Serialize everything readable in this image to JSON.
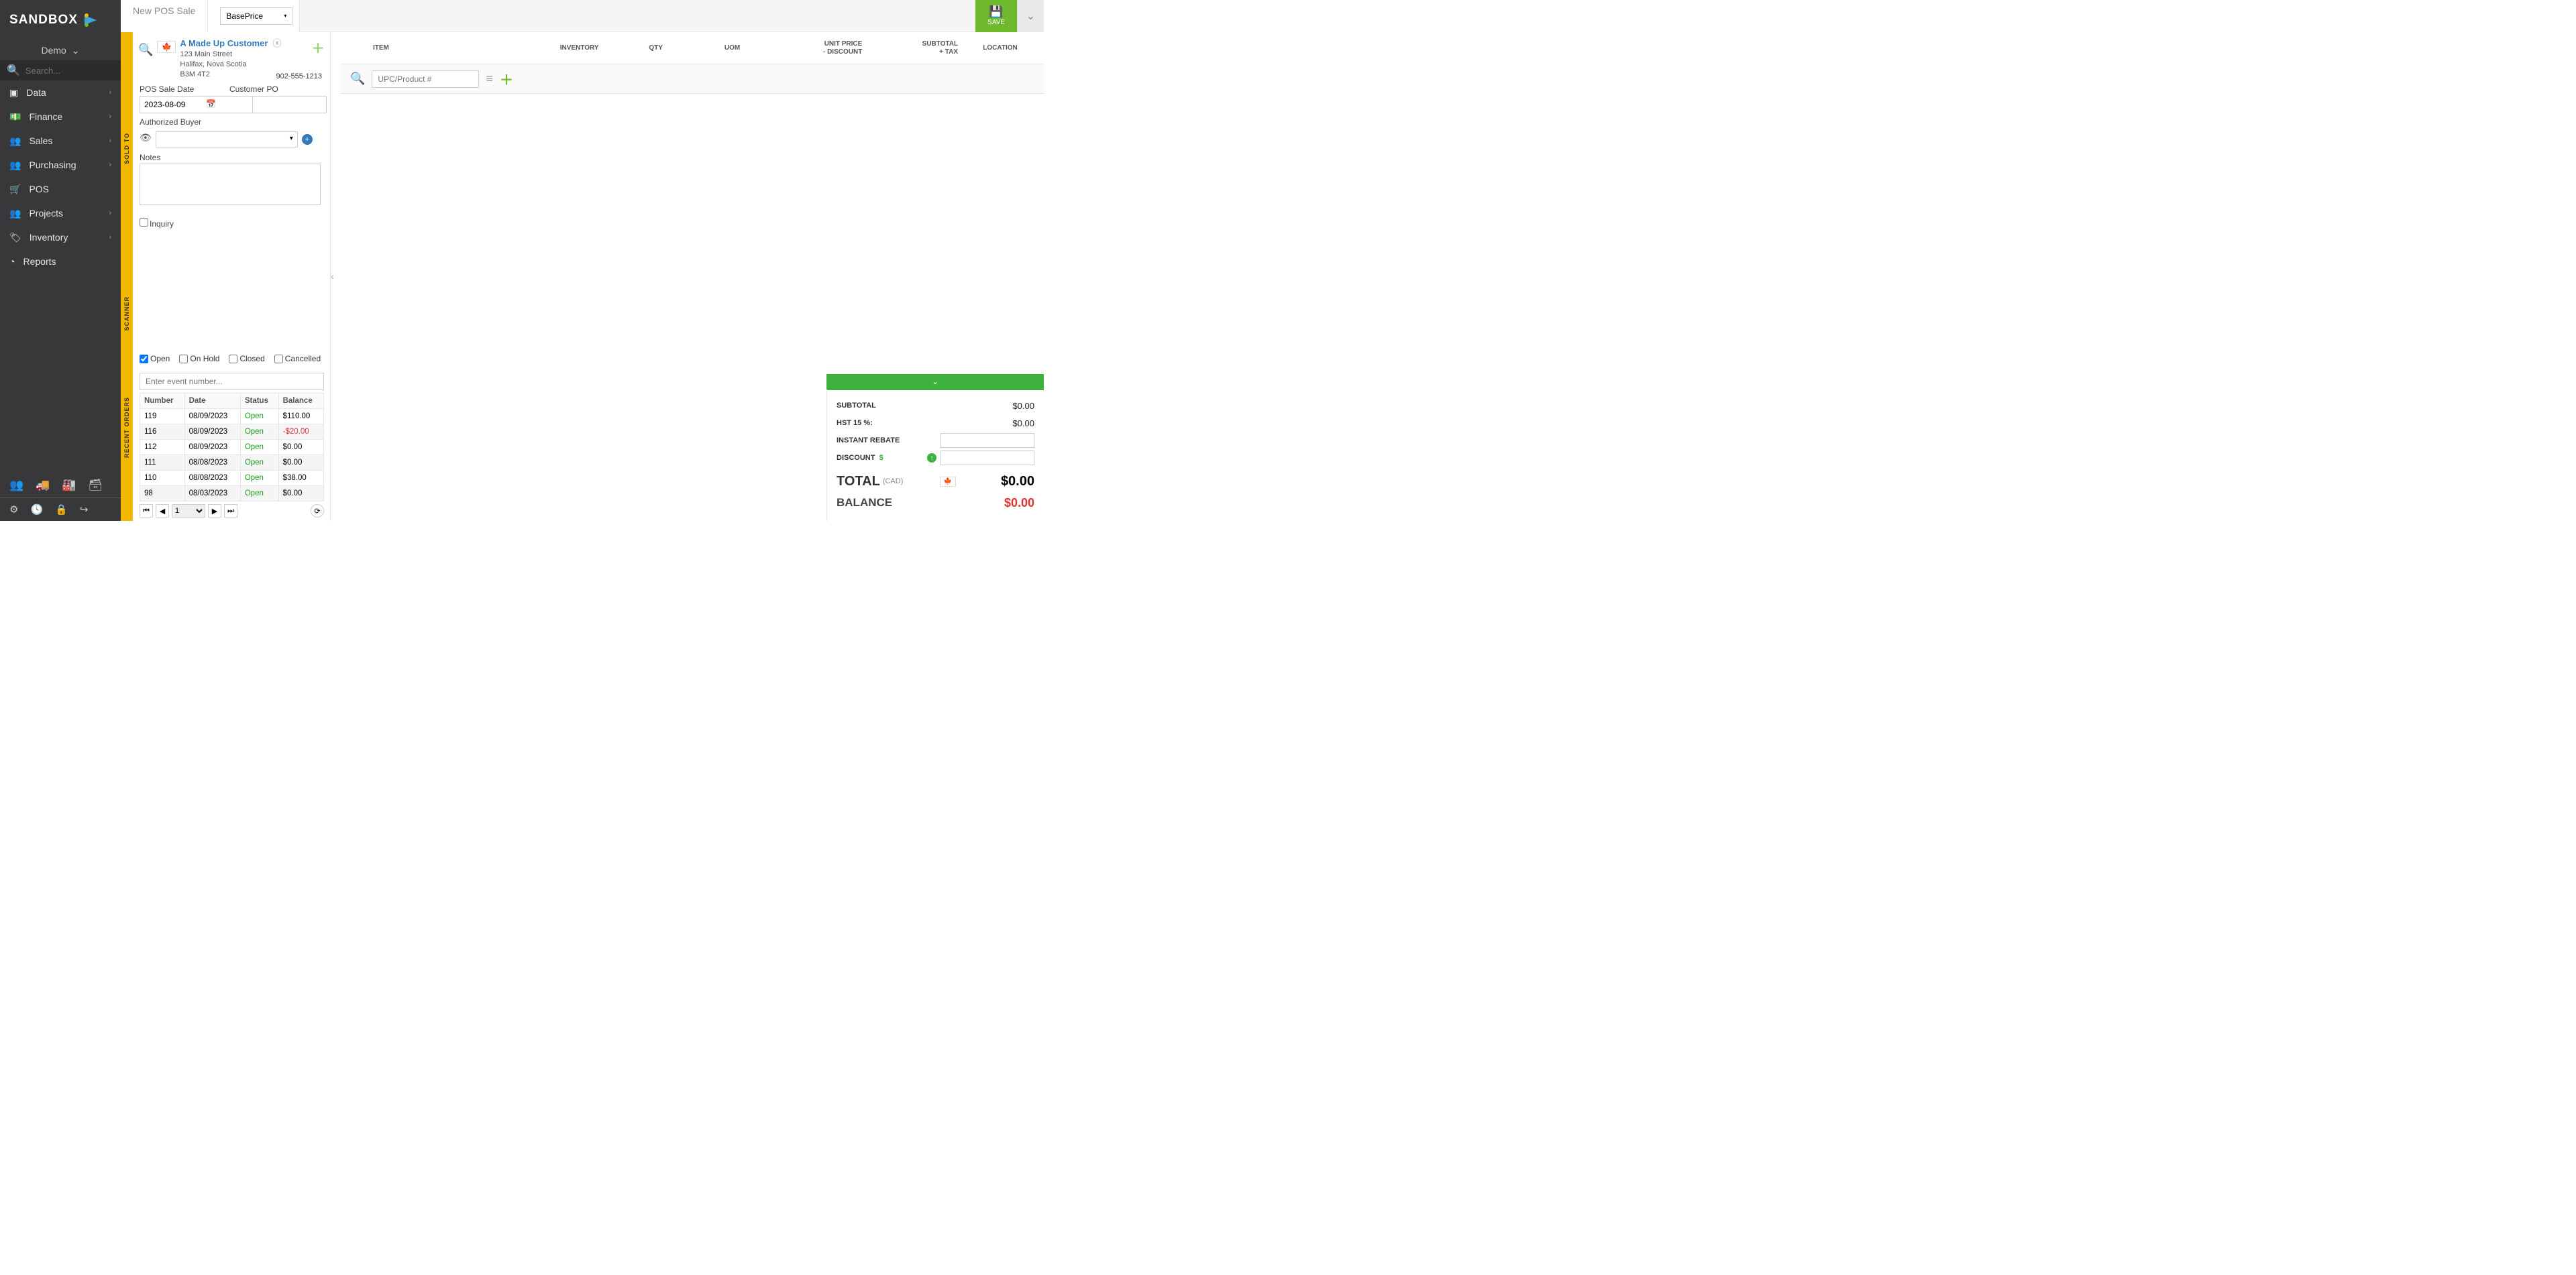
{
  "brand": "SANDBOX",
  "tenant": "Demo",
  "search_placeholder": "Search...",
  "nav": [
    "Data",
    "Finance",
    "Sales",
    "Purchasing",
    "POS",
    "Projects",
    "Inventory",
    "Reports"
  ],
  "title": "New  POS Sale",
  "price_list": "BasePrice",
  "save": "SAVE",
  "customer": {
    "name": "A Made Up Customer",
    "line1": "123 Main Street",
    "line2": "Halifax, Nova Scotia",
    "line3": "B3M 4T2",
    "phone": "902-555-1213"
  },
  "labels": {
    "sale_date": "POS Sale Date",
    "po": "Customer PO",
    "auth": "Authorized Buyer",
    "notes": "Notes",
    "inquiry": "Inquiry"
  },
  "sale_date": "2023-08-09",
  "rails": {
    "soldto": "SOLD TO",
    "scanner": "SCANNER",
    "recent": "RECENT ORDERS"
  },
  "filters": {
    "open": "Open",
    "hold": "On Hold",
    "closed": "Closed",
    "cancelled": "Cancelled"
  },
  "event_placeholder": "Enter event number...",
  "grid_headers": {
    "num": "Number",
    "date": "Date",
    "status": "Status",
    "bal": "Balance"
  },
  "orders": [
    {
      "num": "119",
      "date": "08/09/2023",
      "status": "Open",
      "bal": "$110.00",
      "neg": false
    },
    {
      "num": "116",
      "date": "08/09/2023",
      "status": "Open",
      "bal": "-$20.00",
      "neg": true
    },
    {
      "num": "112",
      "date": "08/09/2023",
      "status": "Open",
      "bal": "$0.00",
      "neg": false
    },
    {
      "num": "111",
      "date": "08/08/2023",
      "status": "Open",
      "bal": "$0.00",
      "neg": false
    },
    {
      "num": "110",
      "date": "08/08/2023",
      "status": "Open",
      "bal": "$38.00",
      "neg": false
    },
    {
      "num": "98",
      "date": "08/03/2023",
      "status": "Open",
      "bal": "$0.00",
      "neg": false
    }
  ],
  "page": "1",
  "items_head": {
    "item": "ITEM",
    "inv": "INVENTORY",
    "qty": "QTY",
    "uom": "UOM",
    "up1": "UNIT PRICE",
    "up2": "- DISCOUNT",
    "st1": "SUBTOTAL",
    "st2": "+ TAX",
    "loc": "LOCATION"
  },
  "upc_placeholder": "UPC/Product #",
  "summary": {
    "subtotal_lbl": "SUBTOTAL",
    "subtotal": "$0.00",
    "tax_lbl": "HST 15 %:",
    "tax": "$0.00",
    "rebate_lbl": "INSTANT REBATE",
    "discount_lbl": "DISCOUNT",
    "total_lbl": "TOTAL",
    "currency": "(CAD)",
    "total": "$0.00",
    "balance_lbl": "BALANCE",
    "balance": "$0.00"
  }
}
